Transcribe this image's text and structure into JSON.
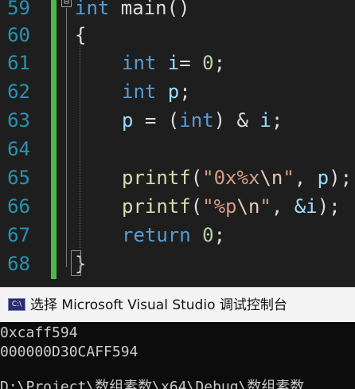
{
  "editor": {
    "line_numbers": [
      "59",
      "60",
      "61",
      "62",
      "63",
      "64",
      "65",
      "66",
      "67",
      "68"
    ],
    "lines": {
      "l59": {
        "type": "int",
        "rest": " main()"
      },
      "l60": {
        "brace": "{"
      },
      "l61": {
        "type": "int",
        "var": " i",
        "op": "= ",
        "num": "0",
        "end": ";"
      },
      "l62": {
        "type": "int",
        "var": " p",
        "end": ";"
      },
      "l63": {
        "var1": "p",
        "op": " = (",
        "type": "int",
        "op2": ") & ",
        "var2": "i",
        "end": ";"
      },
      "l65": {
        "fn": "printf",
        "open": "(",
        "q1": "\"",
        "str_a": "0x%x",
        "esc": "\\n",
        "q2": "\"",
        "sep": ", ",
        "var": "p",
        "close": ");"
      },
      "l66": {
        "fn": "printf",
        "open": "(",
        "q1": "\"",
        "str_a": "%p",
        "esc": "\\n",
        "q2": "\"",
        "sep": ", ",
        "var": "&i",
        "close": ");"
      },
      "l67": {
        "kw": "return",
        "sp": " ",
        "num": "0",
        "end": ";"
      },
      "l68": {
        "brace": "}"
      }
    },
    "fold_glyph": "⊟"
  },
  "console": {
    "icon_label": "C:\\",
    "title": "选择 Microsoft Visual Studio 调试控制台",
    "output": [
      "0xcaff594",
      "000000D30CAFF594",
      "",
      "D:\\Project\\数组素数\\x64\\Debug\\数组素数"
    ]
  },
  "colors": {
    "keyword": "#569cd6",
    "string": "#d69d85",
    "number": "#b5cea8",
    "function": "#dcdcaa",
    "variable": "#9cdcfe",
    "line_number": "#2b91af",
    "change_bar": "#4cb848"
  }
}
